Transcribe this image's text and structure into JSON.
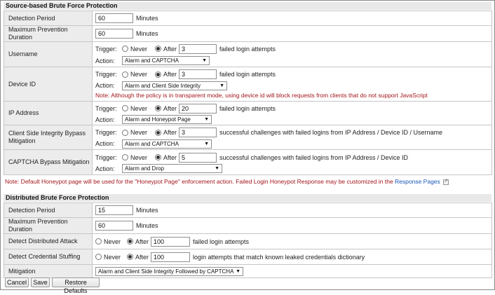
{
  "source_section": {
    "title": "Source-based Brute Force Protection",
    "detection_period": {
      "label": "Detection Period",
      "value": "60",
      "unit": "Minutes"
    },
    "max_prevention": {
      "label": "Maximum Prevention Duration",
      "value": "60",
      "unit": "Minutes"
    },
    "username": {
      "label": "Username",
      "trigger_label": "Trigger:",
      "never": "Never",
      "after": "After",
      "count": "3",
      "suffix": "failed login attempts",
      "action_label": "Action:",
      "action": "Alarm and CAPTCHA"
    },
    "device_id": {
      "label": "Device ID",
      "trigger_label": "Trigger:",
      "never": "Never",
      "after": "After",
      "count": "3",
      "suffix": "failed login attempts",
      "action_label": "Action:",
      "action": "Alarm and Client Side Integrity",
      "note": "Note: Although the policy is in transparent mode, using device id will block requests from clients that do not support JavaScript"
    },
    "ip_address": {
      "label": "IP Address",
      "trigger_label": "Trigger:",
      "never": "Never",
      "after": "After",
      "count": "20",
      "suffix": "failed login attempts",
      "action_label": "Action:",
      "action": "Alarm and Honeypot Page"
    },
    "csi_bypass": {
      "label": "Client Side Integrity Bypass Mitigation",
      "trigger_label": "Trigger:",
      "never": "Never",
      "after": "After",
      "count": "3",
      "suffix": "successful challenges with failed logins from IP Address / Device ID / Username",
      "action_label": "Action:",
      "action": "Alarm and CAPTCHA"
    },
    "captcha_bypass": {
      "label": "CAPTCHA Bypass Mitigation",
      "trigger_label": "Trigger:",
      "never": "Never",
      "after": "After",
      "count": "5",
      "suffix": "successful challenges with failed logins from IP Address / Device ID",
      "action_label": "Action:",
      "action": "Alarm and Drop"
    },
    "footnote": "Note: Default Honeypot page will be used for the \"Honeypot Page\" enforcement action. Failed Login Honeypot Response may be customized in the",
    "footnote_link": "Response Pages"
  },
  "distributed_section": {
    "title": "Distributed Brute Force Protection",
    "detection_period": {
      "label": "Detection Period",
      "value": "15",
      "unit": "Minutes"
    },
    "max_prevention": {
      "label": "Maximum Prevention Duration",
      "value": "60",
      "unit": "Minutes"
    },
    "distributed_attack": {
      "label": "Detect Distributed Attack",
      "never": "Never",
      "after": "After",
      "count": "100",
      "suffix": "failed login attempts"
    },
    "credential_stuffing": {
      "label": "Detect Credential Stuffing",
      "never": "Never",
      "after": "After",
      "count": "100",
      "suffix": "login attempts that match known leaked credentials dictionary"
    },
    "mitigation": {
      "label": "Mitigation",
      "value": "Alarm and Client Side Integrity Followed by CAPTCHA"
    }
  },
  "buttons": {
    "cancel": "Cancel",
    "save": "Save",
    "restore": "Restore Defaults"
  },
  "icons": {
    "dropdown": "chevron-down-icon",
    "external_link": "external-link-icon"
  }
}
